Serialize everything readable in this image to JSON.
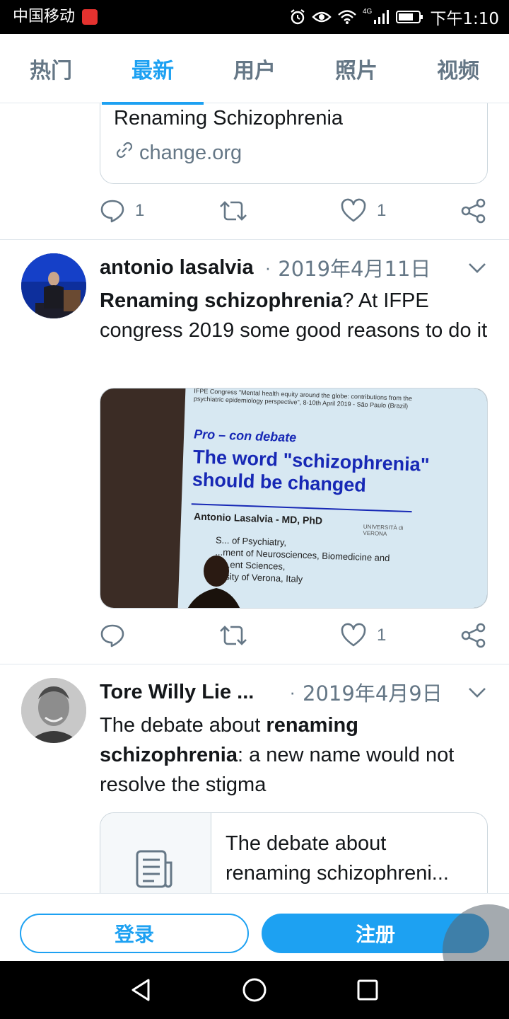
{
  "status_bar": {
    "carrier": "中国移动",
    "network": "4G",
    "time": "下午1:10"
  },
  "tabs": [
    {
      "label": "热门",
      "active": false
    },
    {
      "label": "最新",
      "active": true
    },
    {
      "label": "用户",
      "active": false
    },
    {
      "label": "照片",
      "active": false
    },
    {
      "label": "视频",
      "active": false
    }
  ],
  "top_card": {
    "title": "Renaming Schizophrenia",
    "domain": "change.org",
    "replies": "1",
    "likes": "1"
  },
  "tweet1": {
    "author": "antonio lasalvia",
    "separator": "·",
    "date": "2019年4月11日",
    "text_bold": "Renaming schizophrenia",
    "text_rest": "? At IFPE congress 2019 some good reasons to do it",
    "likes": "1",
    "slide": {
      "header": "IFPE Congress \"Mental health equity around the globe: contributions from the psychiatric epidemiology perspective\", 8-10th April 2019 - São Paulo (Brazil)",
      "procon": "Pro – con debate",
      "title": "The word \"schizophrenia\" should be changed",
      "author": "Antonio Lasalvia - MD, PhD",
      "aff1": "S... of Psychiatry,",
      "aff2": "...ment of Neurosciences, Biomedicine and",
      "aff3": "M...ent Sciences,",
      "aff4": "...rsity of Verona, Italy",
      "logo": "UNIVERSITÀ di VERONA"
    }
  },
  "tweet2": {
    "author": "Tore Willy Lie ...",
    "separator": "·",
    "date": "2019年4月9日",
    "text_start": "The debate about ",
    "text_bold": "renaming schizophrenia",
    "text_rest": ": a new name would not resolve the stigma",
    "card_title_1": "The debate about",
    "card_title_2": "renaming schizophreni..."
  },
  "auth": {
    "login_label": "登录",
    "signup_label": "注册"
  },
  "colors": {
    "accent": "#1da1f2",
    "secondary_text": "#657786",
    "border": "#e1e8ed"
  }
}
